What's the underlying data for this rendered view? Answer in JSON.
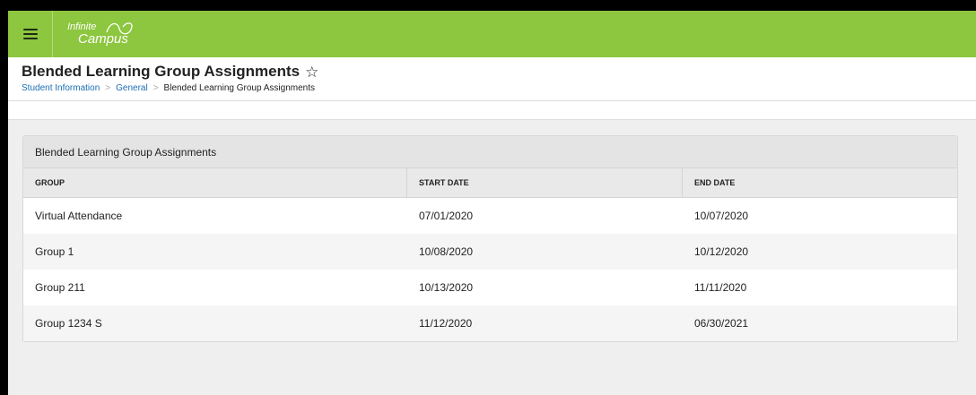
{
  "app": {
    "logo_line1": "Infinite",
    "logo_line2": "Campus",
    "accent_color": "#8dc63f",
    "menu_icon": "hamburger-menu-icon"
  },
  "header": {
    "title": "Blended Learning Group Assignments",
    "favorite_icon": "star-outline-icon",
    "breadcrumb": {
      "items": [
        "Student Information",
        "General"
      ],
      "current": "Blended Learning Group Assignments",
      "separator": ">"
    }
  },
  "panel": {
    "title": "Blended Learning Group Assignments",
    "columns": [
      "GROUP",
      "START DATE",
      "END DATE"
    ],
    "rows": [
      {
        "group": "Virtual Attendance",
        "start": "07/01/2020",
        "end": "10/07/2020"
      },
      {
        "group": "Group 1",
        "start": "10/08/2020",
        "end": "10/12/2020"
      },
      {
        "group": "Group 211",
        "start": "10/13/2020",
        "end": "11/11/2020"
      },
      {
        "group": "Group 1234 S",
        "start": "11/12/2020",
        "end": "06/30/2021"
      }
    ]
  }
}
